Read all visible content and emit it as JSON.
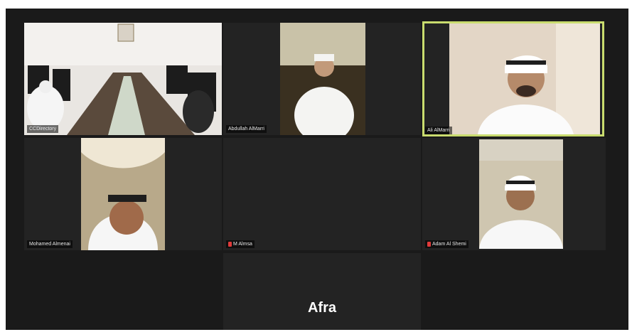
{
  "participants": [
    {
      "name": "CCDirectory",
      "muted": false
    },
    {
      "name": "Abdullah AlMarri",
      "muted": false
    },
    {
      "name": "Ali AlMarri",
      "muted": false,
      "speaking": true
    },
    {
      "name": "Mohamed Almenai",
      "muted": false
    },
    {
      "name": "M Almsa",
      "muted": true
    },
    {
      "name": "Adam Al Shemi",
      "muted": true
    },
    {
      "name": "Afra",
      "muted": false,
      "video_off": true
    }
  ],
  "colors": {
    "active_border": "#c9dc6e",
    "mute_icon": "#e03a3a",
    "background": "#1a1a1a"
  }
}
